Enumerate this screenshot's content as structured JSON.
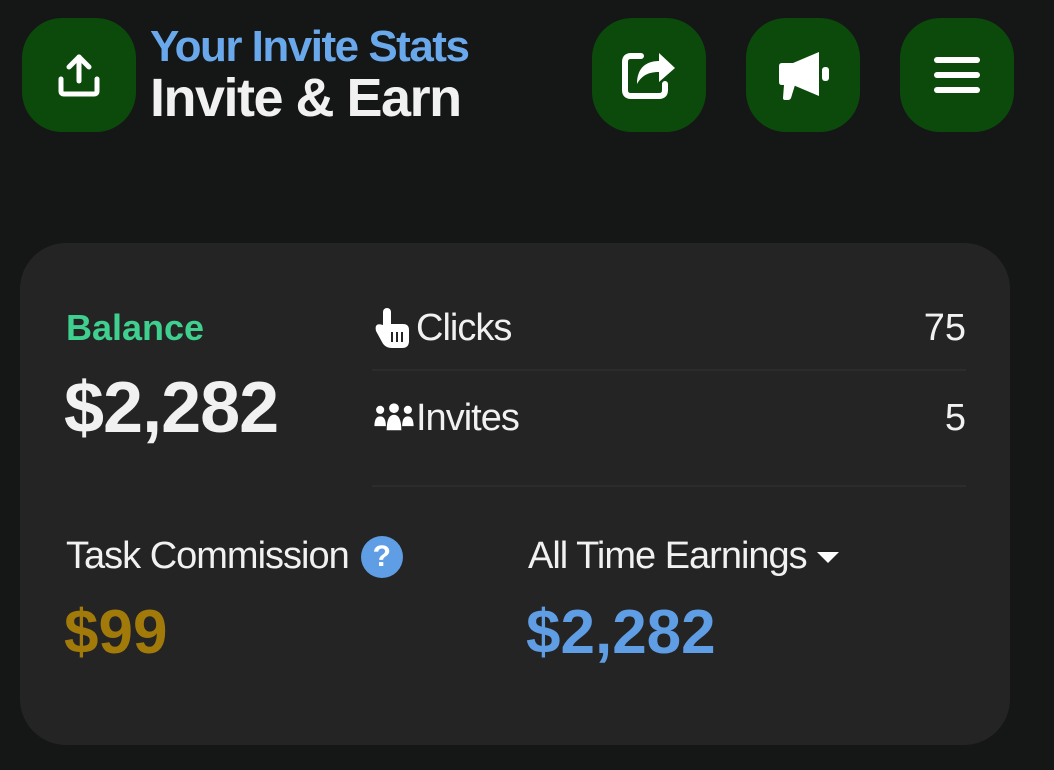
{
  "header": {
    "subtitle": "Your Invite Stats",
    "title": "Invite & Earn",
    "buttons": [
      {
        "icon": "upload-icon"
      },
      {
        "icon": "share-icon"
      },
      {
        "icon": "megaphone-icon"
      },
      {
        "icon": "menu-icon"
      }
    ],
    "button_color": "#0b4a0b"
  },
  "card": {
    "balance_label": "Balance",
    "balance_value": "$2,282",
    "stats": [
      {
        "icon": "pointer-hand-icon",
        "label": "Clicks",
        "value": "75"
      },
      {
        "icon": "group-icon",
        "label": "Invites",
        "value": "5"
      }
    ],
    "task_commission_label": "Task Commission",
    "task_commission_value": "$99",
    "task_commission_help_icon": "question-icon",
    "help_glyph": "?",
    "all_time_label": "All Time Earnings",
    "all_time_value": "$2,282",
    "all_time_dropdown_icon": "caret-down-icon"
  },
  "colors": {
    "background": "#151616",
    "card": "#242424",
    "balance_label": "#3fcf8e",
    "subtitle": "#6aa8ec",
    "task_commission": "#a27a0a",
    "all_time": "#5f9de5"
  }
}
